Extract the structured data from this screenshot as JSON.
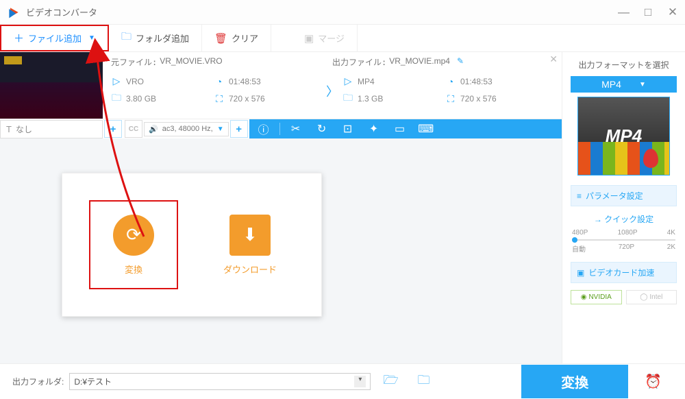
{
  "app": {
    "title": "ビデオコンバータ"
  },
  "toolbar": {
    "add_file": "ファイル追加",
    "add_folder": "フォルダ追加",
    "clear": "クリア",
    "merge": "マージ"
  },
  "file": {
    "source_label": "元ファイル:",
    "output_label": "出力ファイル:",
    "source_name": "VR_MOVIE.VRO",
    "output_name": "VR_MOVIE.mp4",
    "src": {
      "format": "VRO",
      "duration": "01:48:53",
      "size": "3.80 GB",
      "resolution": "720 x 576"
    },
    "out": {
      "format": "MP4",
      "duration": "01:48:53",
      "size": "1.3 GB",
      "resolution": "720 x 576"
    }
  },
  "subtitle": {
    "none_label": "なし",
    "audio_track": "ac3, 48000 Hz,"
  },
  "dropzone": {
    "convert": "変換",
    "download": "ダウンロード"
  },
  "right": {
    "header": "出力フォーマットを選択",
    "format": "MP4",
    "format_big": "MP4",
    "param_btn": "パラメータ設定",
    "quick_header": "クイック設定",
    "quality_top": [
      "480P",
      "1080P",
      "4K"
    ],
    "quality_bottom": [
      "自動",
      "720P",
      "2K"
    ],
    "gpu_btn": "ビデオカード加速",
    "nvidia": "NVIDIA",
    "intel": "Intel"
  },
  "footer": {
    "label": "出力フォルダ:",
    "path": "D:¥テスト",
    "convert_btn": "変換"
  }
}
